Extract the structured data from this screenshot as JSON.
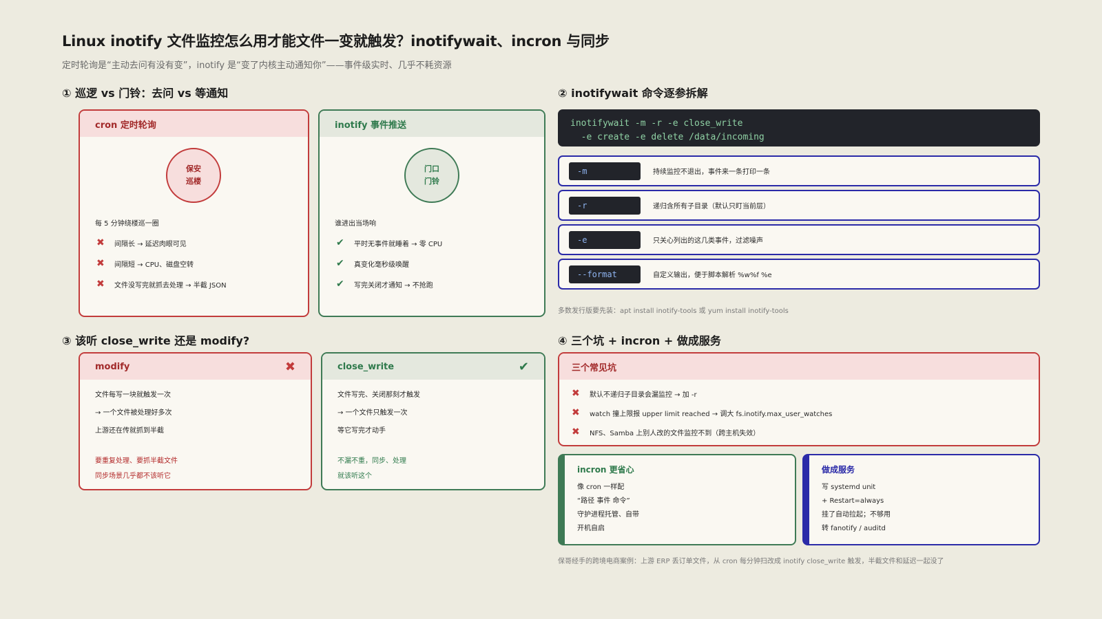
{
  "header": {
    "title": "Linux inotify 文件监控怎么用才能文件一变就触发？inotifywait、incron 与同步",
    "subtitle": "定时轮询是“主动去问有没有变”，inotify 是“变了内核主动通知你”——事件级实时、几乎不耗资源"
  },
  "s1": {
    "title": "① 巡逻 vs 门铃：去问 vs 等通知",
    "cron": {
      "head": "cron 定时轮询",
      "circle_line1": "保安",
      "circle_line2": "巡楼",
      "lead": "每 5 分钟绕楼巡一圈",
      "items": [
        "间隔长 → 延迟肉眼可见",
        "间隔短 → CPU、磁盘空转",
        "文件没写完就抓去处理 → 半截 JSON"
      ]
    },
    "inotify": {
      "head": "inotify 事件推送",
      "circle_line1": "门口",
      "circle_line2": "门铃",
      "lead": "谁进出当场响",
      "items": [
        "平时无事件就睡着 → 零 CPU",
        "真变化毫秒级唤醒",
        "写完关闭才通知 → 不抢跑"
      ]
    }
  },
  "s2": {
    "title": "② inotifywait 命令逐参拆解",
    "command": "inotifywait -m -r -e close_write\n  -e create -e delete /data/incoming",
    "flags": [
      {
        "code": "-m",
        "desc": "持续监控不退出，事件来一条打印一条"
      },
      {
        "code": "-r",
        "desc": "递归含所有子目录（默认只盯当前层）"
      },
      {
        "code": "-e",
        "desc": "只关心列出的这几类事件，过滤噪声"
      },
      {
        "code": "--format",
        "desc": "自定义输出，便于脚本解析 %w%f %e"
      }
    ],
    "note": "多数发行版要先装：apt install inotify-tools 或 yum install inotify-tools"
  },
  "s3": {
    "title": "③ 该听 close_write 还是 modify?",
    "modify": {
      "head": "modify",
      "lines": [
        "文件每写一块就触发一次",
        "→ 一个文件被处理好多次",
        "上游还在传就抓到半截"
      ],
      "conclusion": [
        "要重复处理、要抓半截文件",
        "同步场景几乎都不该听它"
      ]
    },
    "close_write": {
      "head": "close_write",
      "lines": [
        "文件写完、关闭那刻才触发",
        "→ 一个文件只触发一次",
        "等它写完才动手"
      ],
      "conclusion": [
        "不漏不重，同步、处理",
        "就该听这个"
      ]
    }
  },
  "s4": {
    "title": "④ 三个坑 + incron + 做成服务",
    "pitfalls": {
      "head": "三个常见坑",
      "items": [
        "默认不递归子目录会漏监控 → 加 -r",
        "watch 撞上限报 upper limit reached → 调大 fs.inotify.max_user_watches",
        "NFS、Samba 上别人改的文件监控不到（跨主机失效）"
      ]
    },
    "incron": {
      "head": "incron 更省心",
      "lines": [
        "像 cron 一样配",
        "“路径 事件 命令”",
        "守护进程托管、自带",
        "开机自启"
      ]
    },
    "service": {
      "head": "做成服务",
      "lines": [
        "写 systemd unit",
        "+ Restart=always",
        "挂了自动拉起；不够用",
        "转 fanotify / auditd"
      ]
    },
    "note": "保哥经手的跨境电商案例：上游 ERP 丢订单文件，从 cron 每分钟扫改成 inotify close_write 触发，半截文件和延迟一起没了"
  },
  "icons": {
    "cross": "✖",
    "check": "✔"
  },
  "colors": {
    "red": "#c23b3b",
    "green": "#3e7a55",
    "blue": "#2a2aa8",
    "dark": "#22242a",
    "bg": "#edebe0"
  }
}
